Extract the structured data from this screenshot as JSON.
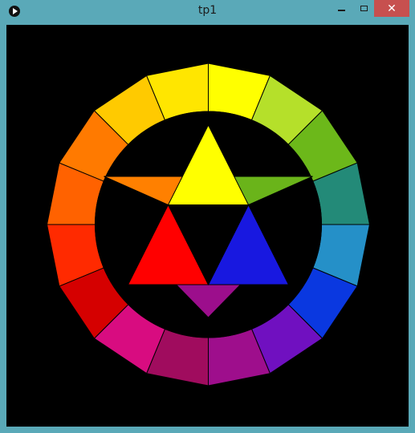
{
  "window": {
    "title": "tp1",
    "frame_color": "#5aa9b8",
    "canvas_background": "#000000"
  },
  "titlebar": {
    "app_icon": "play-icon",
    "minimize_icon": "minimize-icon",
    "maximize_icon": "maximize-icon",
    "close_icon": "close-icon",
    "close_glyph": "✕"
  },
  "color_wheel": {
    "ring_segments_clockwise_from_top": [
      "#ffff00",
      "#b5e02a",
      "#6cb81a",
      "#238a78",
      "#2590c8",
      "#0a38e0",
      "#7010c0",
      "#9e0e8c",
      "#a00c5e",
      "#d80c80",
      "#d50000",
      "#ff2a00",
      "#ff6200",
      "#ff7a00",
      "#ffca00",
      "#ffe600"
    ],
    "inner_triangles": {
      "yellow": "#ffff00",
      "red": "#ff0000",
      "blue": "#1818e0",
      "orange": "#ff8000",
      "green": "#6ab41a",
      "purple": "#9c0e8c"
    },
    "outline_color": "#000000"
  }
}
